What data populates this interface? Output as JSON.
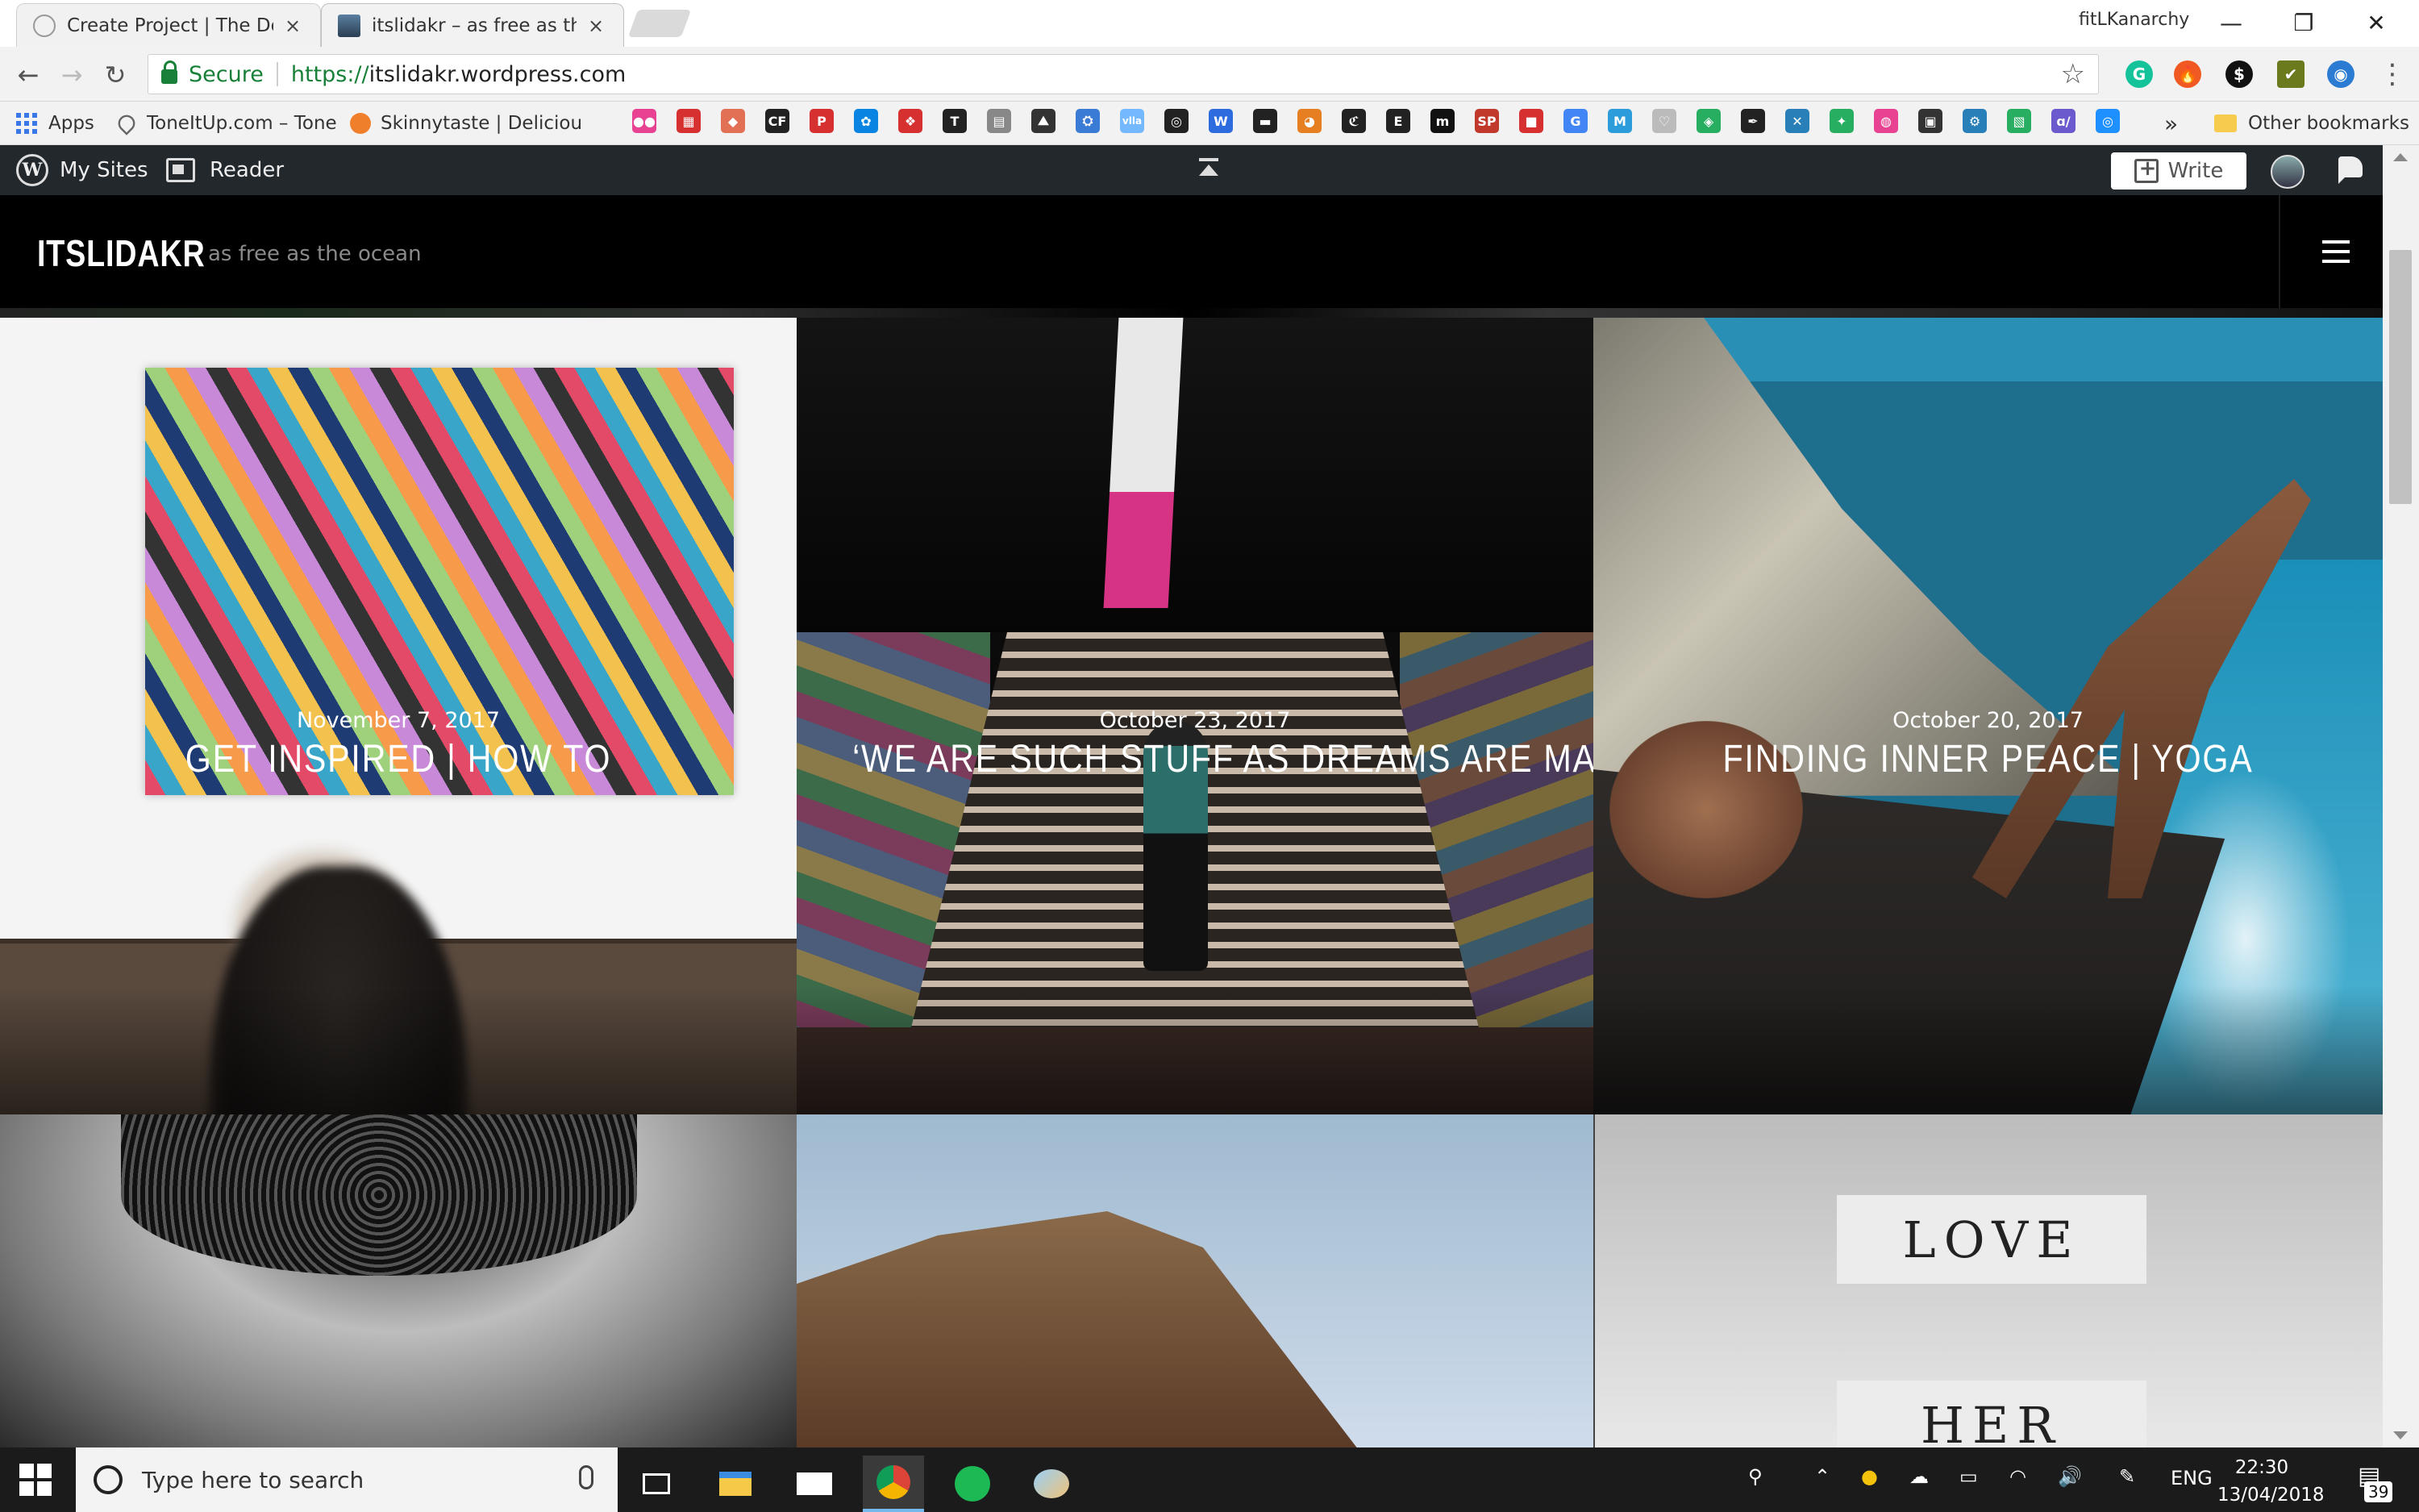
{
  "browser": {
    "tabs": [
      {
        "title": "Create Project | The Dots",
        "close": "×"
      },
      {
        "title": "itslidakr – as free as the o",
        "close": "×"
      }
    ],
    "profile": "fitLKanarchy",
    "window_controls": {
      "minimize": "—",
      "restore": "❐",
      "close": "✕"
    },
    "nav": {
      "back": "←",
      "forward": "→",
      "reload": "↻"
    },
    "security_label": "Secure",
    "url_scheme": "https://",
    "url_host": "itslidakr.wordpress.com",
    "bookmark_star": "☆",
    "menu": "⋮",
    "extensions": [
      {
        "name": "grammarly-icon",
        "glyph": "G",
        "color": "#15c39a"
      },
      {
        "name": "flame-icon",
        "glyph": "🔥",
        "color": "#f05a22"
      },
      {
        "name": "dollar-icon",
        "glyph": "$",
        "color": "#111111"
      },
      {
        "name": "check-icon",
        "glyph": "✔",
        "color": "#6c7a1e"
      },
      {
        "name": "profile-extension-icon",
        "glyph": "◉",
        "color": "#2a7bd1"
      }
    ]
  },
  "bookmarks": {
    "apps": "Apps",
    "items": [
      {
        "label": "ToneItUp.com – Tone"
      },
      {
        "label": "Skinnytaste | Deliciou"
      }
    ],
    "icon_glyphs": [
      "●●",
      "▦",
      "◆",
      "CF",
      "P",
      "✿",
      "❖",
      "T",
      "▤",
      "⛰",
      "⛭",
      "vlla",
      "◎",
      "W",
      "▬",
      "◕",
      "ℭ",
      "E",
      "m",
      "SP",
      "■",
      "G",
      "M",
      "♡",
      "◈",
      "✒",
      "✕",
      "✦",
      "◍",
      "▣",
      "⚙",
      "▧",
      "ɑ/",
      "◎"
    ],
    "overflow": "»",
    "other": "Other bookmarks"
  },
  "wp_admin": {
    "my_sites": "My Sites",
    "reader": "Reader",
    "write": "Write"
  },
  "site": {
    "title": "ITSLIDAKR",
    "tagline": "as free as the ocean"
  },
  "posts": [
    {
      "date": "November 7, 2017",
      "title": "GET INSPIRED | HOW TO"
    },
    {
      "date": "October 23, 2017",
      "title": "‘WE ARE SUCH STUFF AS DREAMS ARE MADE ON’"
    },
    {
      "date": "October 20, 2017",
      "title": "FINDING INNER PEACE | YOGA"
    }
  ],
  "lower_post_card": {
    "word1": "LOVE",
    "word2": "HER"
  },
  "scroll": {
    "thumb_top_fraction": 0.07,
    "thumb_size_fraction": 0.2
  },
  "taskbar": {
    "search_placeholder": "Type here to search",
    "language": "ENG",
    "time": "22:30",
    "date": "13/04/2018",
    "notification_count": "39"
  }
}
